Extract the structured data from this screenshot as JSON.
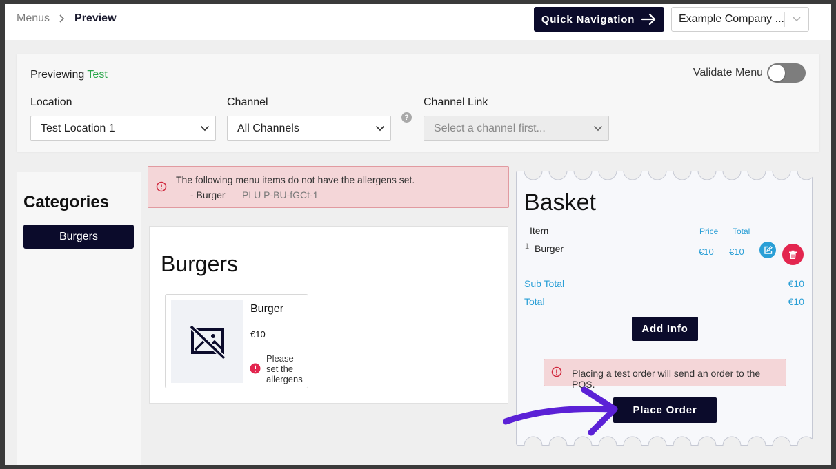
{
  "breadcrumb": {
    "parent": "Menus",
    "current": "Preview"
  },
  "header": {
    "quick_nav_label": "Quick Navigation",
    "company_select": "Example Company ..."
  },
  "filters": {
    "previewing_prefix": "Previewing",
    "previewing_name": "Test",
    "validate_label": "Validate Menu",
    "validate_on": false,
    "location_label": "Location",
    "location_value": "Test Location 1",
    "channel_label": "Channel",
    "channel_value": "All Channels",
    "channel_help": "?",
    "channel_link_label": "Channel Link",
    "channel_link_placeholder": "Select a channel first..."
  },
  "categories": {
    "title": "Categories",
    "items": [
      {
        "label": "Burgers"
      }
    ]
  },
  "allergen_alert": {
    "message": "The following menu items do not have the allergens set.",
    "item": "- Burger",
    "plu": "PLU P-BU-fGCt-1"
  },
  "menu": {
    "section_title": "Burgers",
    "products": [
      {
        "name": "Burger",
        "price": "€10",
        "warning": "Please set the allergens",
        "image": "image-off-icon"
      }
    ]
  },
  "basket": {
    "title": "Basket",
    "col_item": "Item",
    "col_price": "Price",
    "col_total": "Total",
    "rows": [
      {
        "qty": "1",
        "name": "Burger",
        "price": "€10",
        "total": "€10"
      }
    ],
    "subtotal_label": "Sub Total",
    "subtotal_value": "€10",
    "total_label": "Total",
    "total_value": "€10",
    "add_info_label": "Add Info",
    "order_warning": "Placing a test order will send an order to the POS.",
    "place_order_label": "Place Order"
  },
  "colors": {
    "primary_dark": "#0b0b2b",
    "accent_blue": "#2a9fd6",
    "danger_red": "#e3264f",
    "success_green": "#2aa64a",
    "annotation_purple": "#5b21d6"
  }
}
